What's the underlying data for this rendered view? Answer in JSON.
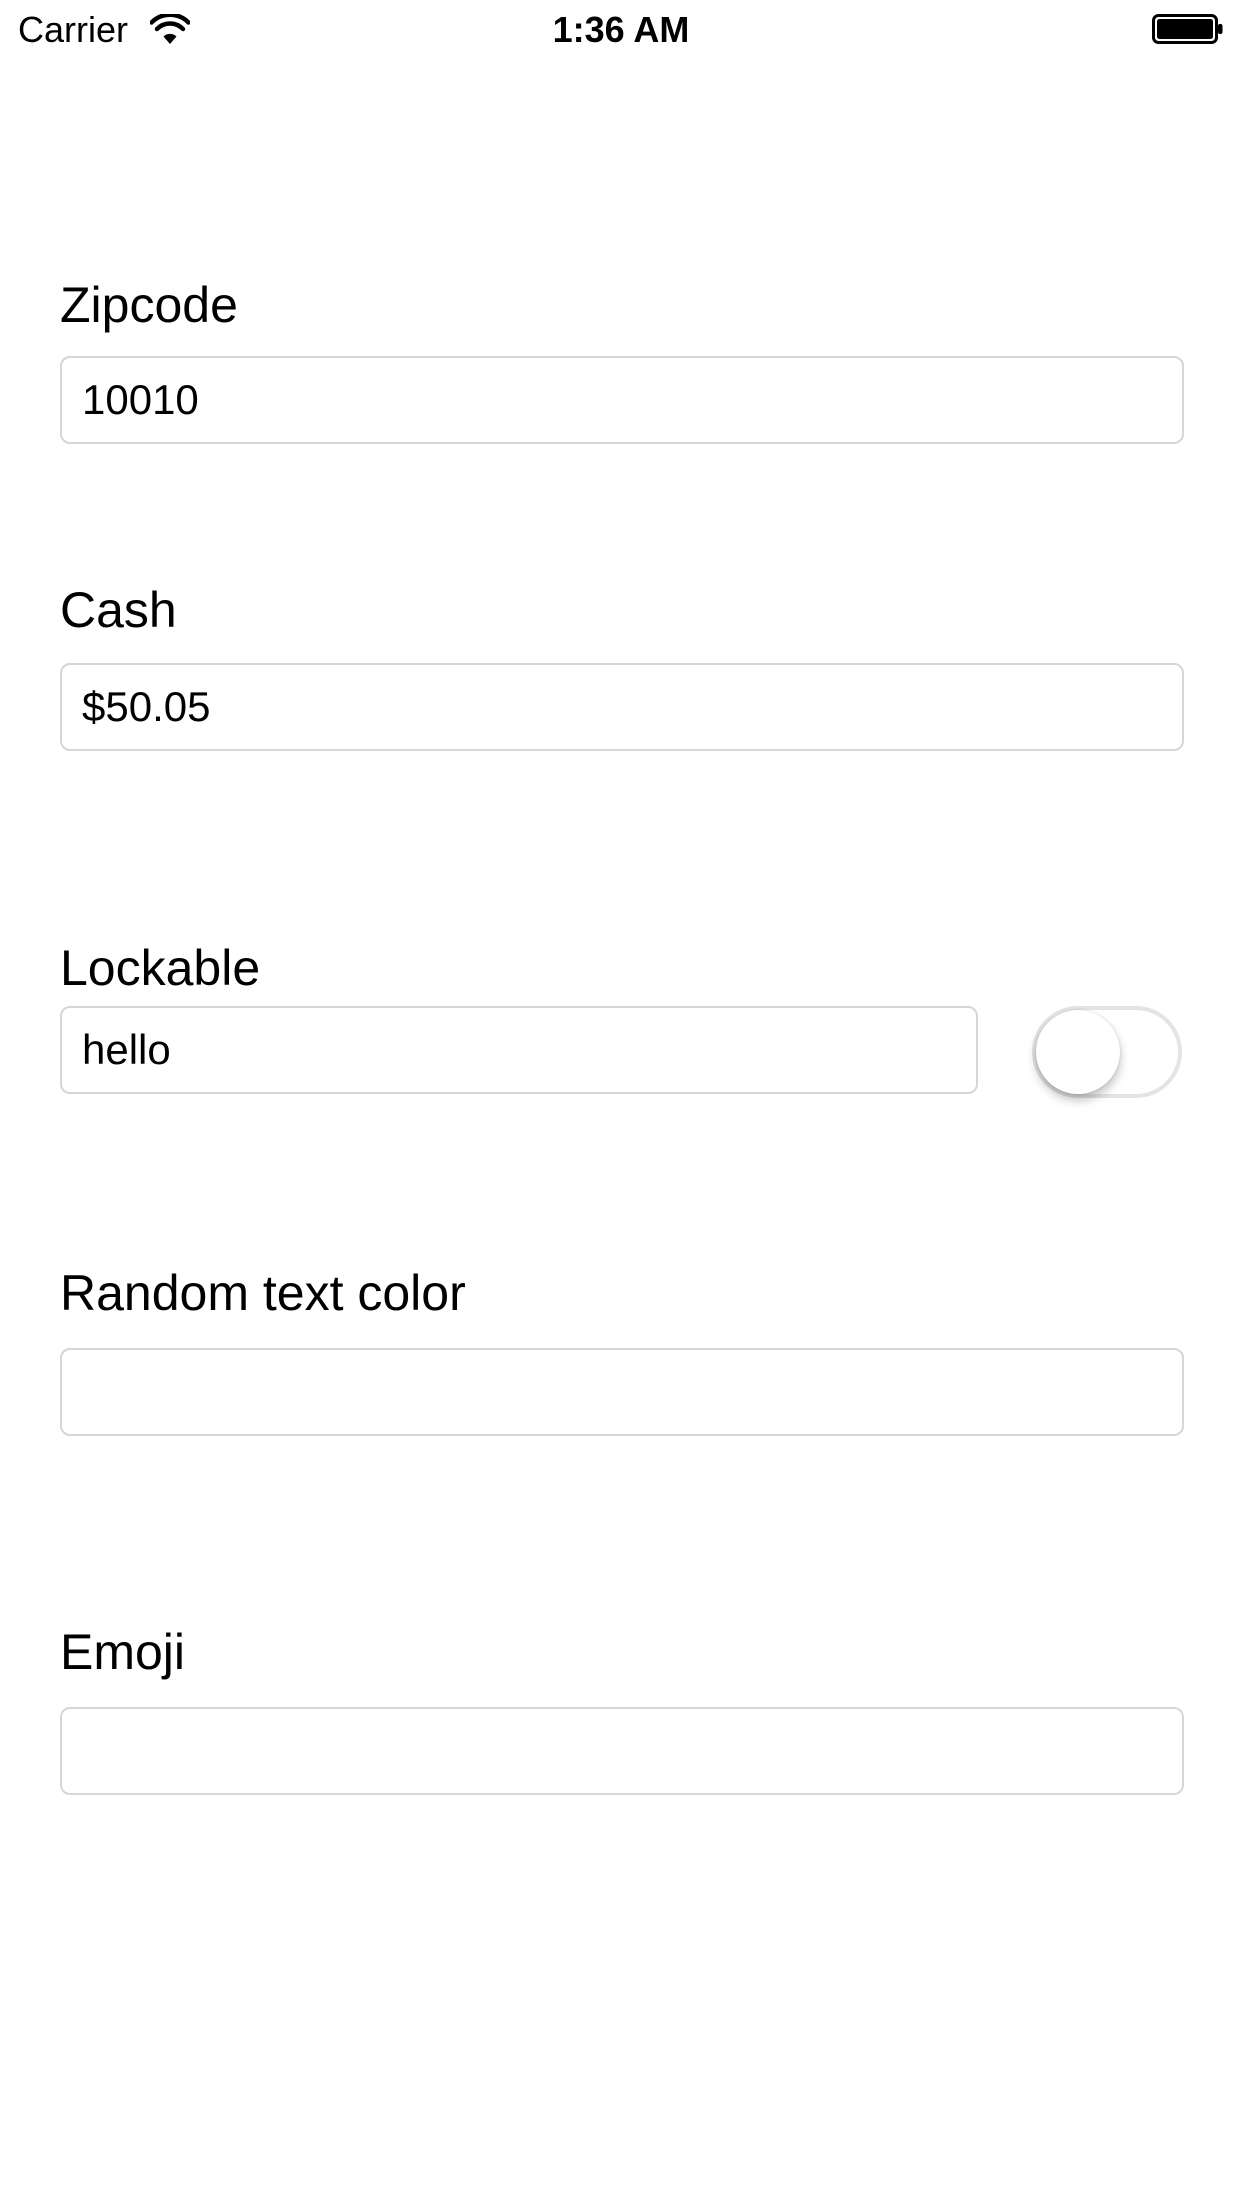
{
  "status_bar": {
    "carrier": "Carrier",
    "time": "1:36 AM",
    "wifi_icon": "wifi-icon",
    "battery_icon": "battery-icon"
  },
  "form": {
    "zipcode": {
      "label": "Zipcode",
      "value": "10010"
    },
    "cash": {
      "label": "Cash",
      "value": "$50.05"
    },
    "lockable": {
      "label": "Lockable",
      "value": "hello",
      "toggle_on": false
    },
    "random_text_color": {
      "label": "Random text color",
      "value": ""
    },
    "emoji": {
      "label": "Emoji",
      "value": ""
    }
  },
  "colors": {
    "background": "#ffffff",
    "field_border": "#d6d6d6",
    "toggle_border": "#e4e4e4",
    "text": "#000000"
  }
}
